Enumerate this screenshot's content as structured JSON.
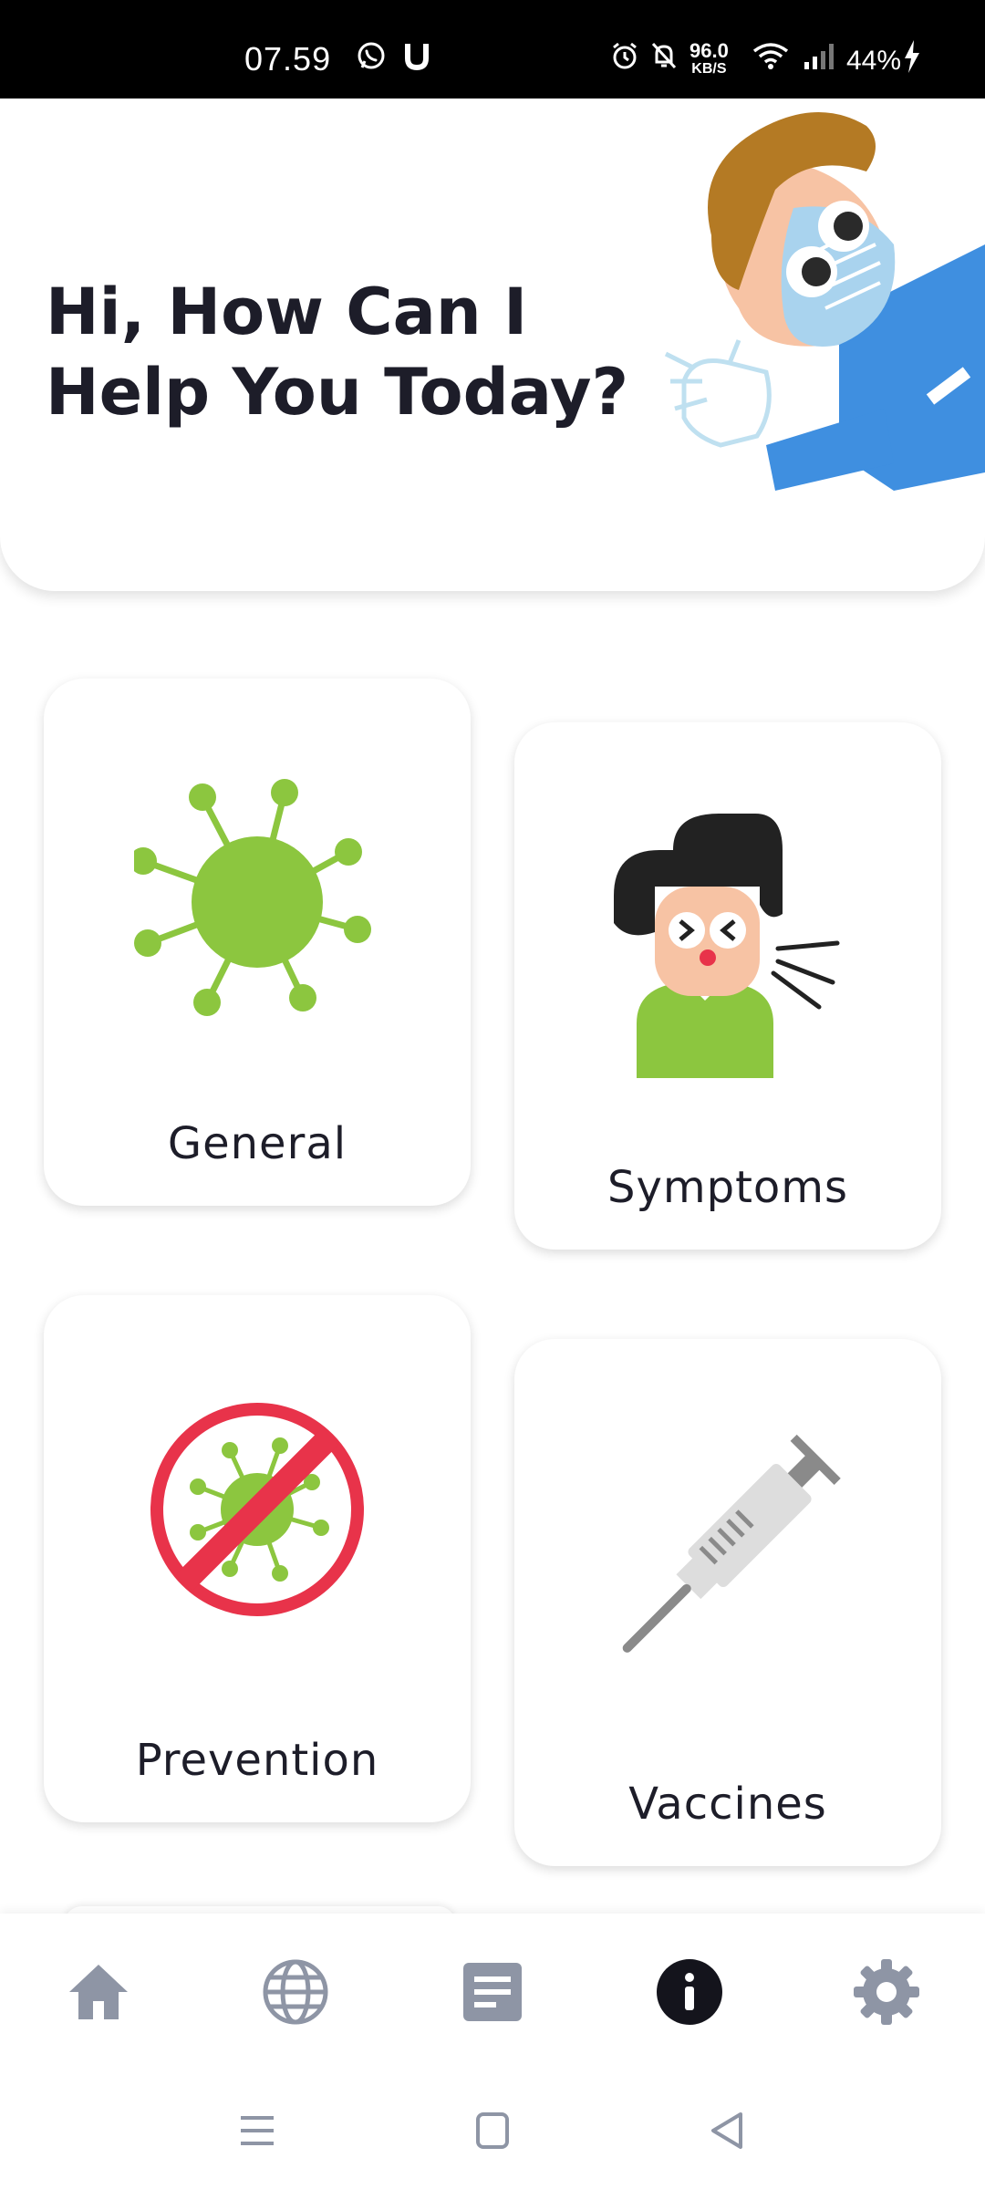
{
  "status_bar": {
    "time": "07.59",
    "net_speed_value": "96.0",
    "net_speed_unit": "KB/S",
    "battery": "44%",
    "icons": [
      "whatsapp-icon",
      "u-app-icon",
      "alarm-icon",
      "mute-icon",
      "wifi-icon",
      "signal-icon",
      "charging-icon"
    ]
  },
  "header": {
    "title": "Hi, How Can I Help You Today?",
    "illustration": "masked-doctor-waving"
  },
  "categories": [
    {
      "label": "General",
      "icon": "virus-icon"
    },
    {
      "label": "Symptoms",
      "icon": "sneezing-person-icon"
    },
    {
      "label": "Prevention",
      "icon": "no-virus-icon"
    },
    {
      "label": "Vaccines",
      "icon": "syringe-icon"
    }
  ],
  "bottom_nav": {
    "items": [
      {
        "name": "home",
        "icon": "home-icon",
        "active": false
      },
      {
        "name": "globe",
        "icon": "globe-icon",
        "active": false
      },
      {
        "name": "news",
        "icon": "document-icon",
        "active": false
      },
      {
        "name": "info",
        "icon": "info-icon",
        "active": true
      },
      {
        "name": "settings",
        "icon": "gear-icon",
        "active": false
      }
    ]
  },
  "colors": {
    "accent_green": "#8cc63f",
    "prohibit_red": "#e8334a",
    "nav_inactive": "#8e95a5",
    "nav_active": "#14141c",
    "title_text": "#1d1d29"
  }
}
